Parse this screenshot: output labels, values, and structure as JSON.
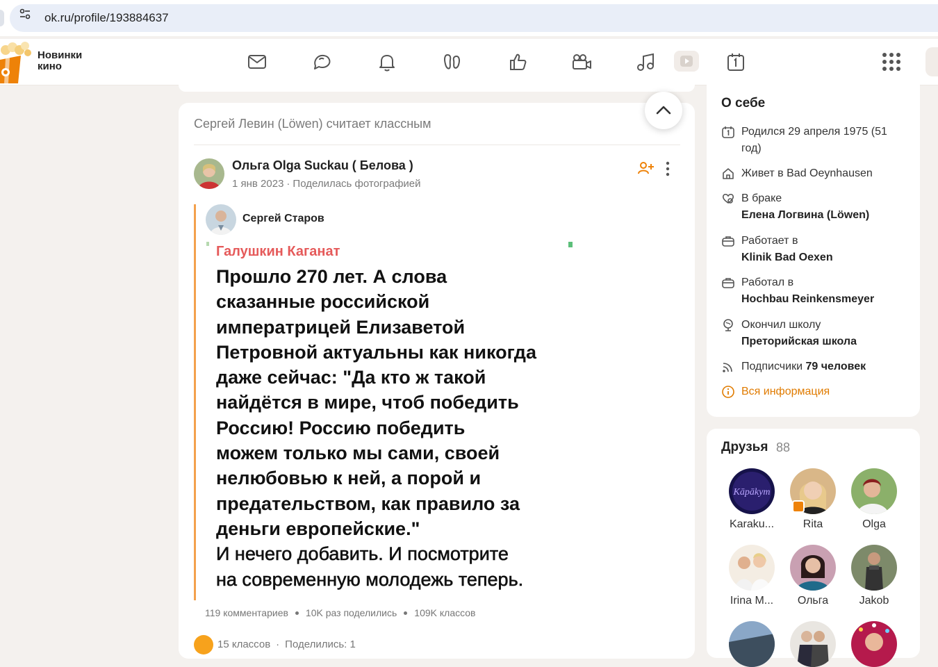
{
  "browser": {
    "url": "ok.ru/profile/193884637"
  },
  "header": {
    "promo_line1": "Новинки",
    "promo_line2": "кино",
    "nav_icons": [
      "mail-icon",
      "discussions-icon",
      "notifications-icon",
      "guests-icon",
      "likes-icon",
      "video-icon",
      "music-icon",
      "calendar-icon"
    ],
    "brand_color": "#ee8208"
  },
  "feed": {
    "liked_by": "Сергей Левин (Löwen) считает классным",
    "author": {
      "name": "Ольга Olga Suckau ( Белова )",
      "date": "1 янв 2023",
      "action": "Поделилась фотографией"
    },
    "repost": {
      "name": "Сергей Старов",
      "photo_channel": "Галушкин Каганат",
      "photo_text_lines": [
        "Прошло 270 лет. А слова",
        "сказанные российской",
        "императрицей Елизаветой",
        "Петровной актуальны как никогда",
        "даже сейчас: \"Да кто ж такой",
        "найдётся в мире, чтоб победить",
        "Россию! Россию победить",
        "можем только мы сами, своей",
        "нелюбовью к ней, а порой и",
        "предательством, как правило за",
        "деньги европейские.\"",
        "И нечего добавить. И посмотрите",
        "на современную молодежь теперь."
      ],
      "comments": "119 комментариев",
      "shares": "10K раз поделились",
      "classes": "109K классов"
    },
    "own_classes": "15 классов",
    "own_shared": "Поделились: 1"
  },
  "about": {
    "title": "О себе",
    "born": "Родился 29 апреля 1975 (51 год)",
    "lives_label": "Живет в ",
    "lives": "Bad Oeynhausen",
    "married_label": "В браке",
    "married": "Елена Логвина (Löwen)",
    "works_label": "Работает в",
    "works": "Klinik Bad Oexen",
    "worked_label": "Работал в",
    "worked": "Hochbau Reinkensmeyer",
    "school_label": "Окончил школу",
    "school": "Преторийская школа",
    "subs_label": "Подписчики ",
    "subs": "79 человек",
    "all_info": "Вся информация"
  },
  "friends": {
    "title": "Друзья",
    "count": "88",
    "list": [
      {
        "name": "Karaku..."
      },
      {
        "name": "Rita"
      },
      {
        "name": "Olga"
      },
      {
        "name": "Irina M..."
      },
      {
        "name": "Ольга"
      },
      {
        "name": "Jakob"
      }
    ]
  }
}
